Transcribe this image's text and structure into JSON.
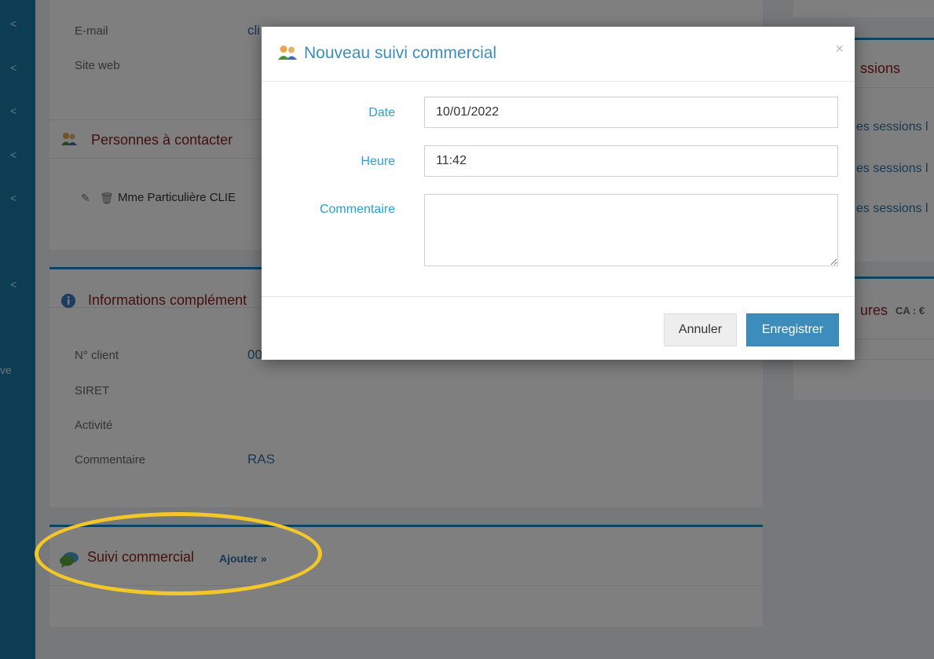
{
  "sidebar": {
    "chevrons": [
      "<",
      "<",
      "<",
      "<",
      "<",
      "<"
    ],
    "fragment_text": "ve"
  },
  "contact": {
    "email_label": "E-mail",
    "email_value": "cli",
    "website_label": "Site web"
  },
  "persons": {
    "title": "Personnes à contacter",
    "row_text": "Mme Particulière CLIE"
  },
  "info": {
    "title": "Informations complément",
    "rows": [
      {
        "label": "N° client",
        "value": "00"
      },
      {
        "label": "SIRET",
        "value": ""
      },
      {
        "label": "Activité",
        "value": ""
      },
      {
        "label": "Commentaire",
        "value": "RAS"
      }
    ]
  },
  "suivi": {
    "title": "Suivi commercial",
    "add_link": "Ajouter »"
  },
  "right": {
    "sessions_title": "ssions",
    "session_links": [
      "es sessions l",
      "es sessions l",
      "es sessions l"
    ],
    "factures_title": "ures",
    "ca_label": "CA : €"
  },
  "modal": {
    "title": "Nouveau suivi commercial",
    "close": "×",
    "date_label": "Date",
    "date_value": "10/01/2022",
    "time_label": "Heure",
    "time_value": "11:42",
    "comment_label": "Commentaire",
    "comment_value": "",
    "cancel_label": "Annuler",
    "save_label": "Enregistrer"
  },
  "colors": {
    "sidebar": "#1a7aa6",
    "accent": "#3c8dbc",
    "title_red": "#8a1d1d",
    "highlight": "#f3c72a"
  }
}
